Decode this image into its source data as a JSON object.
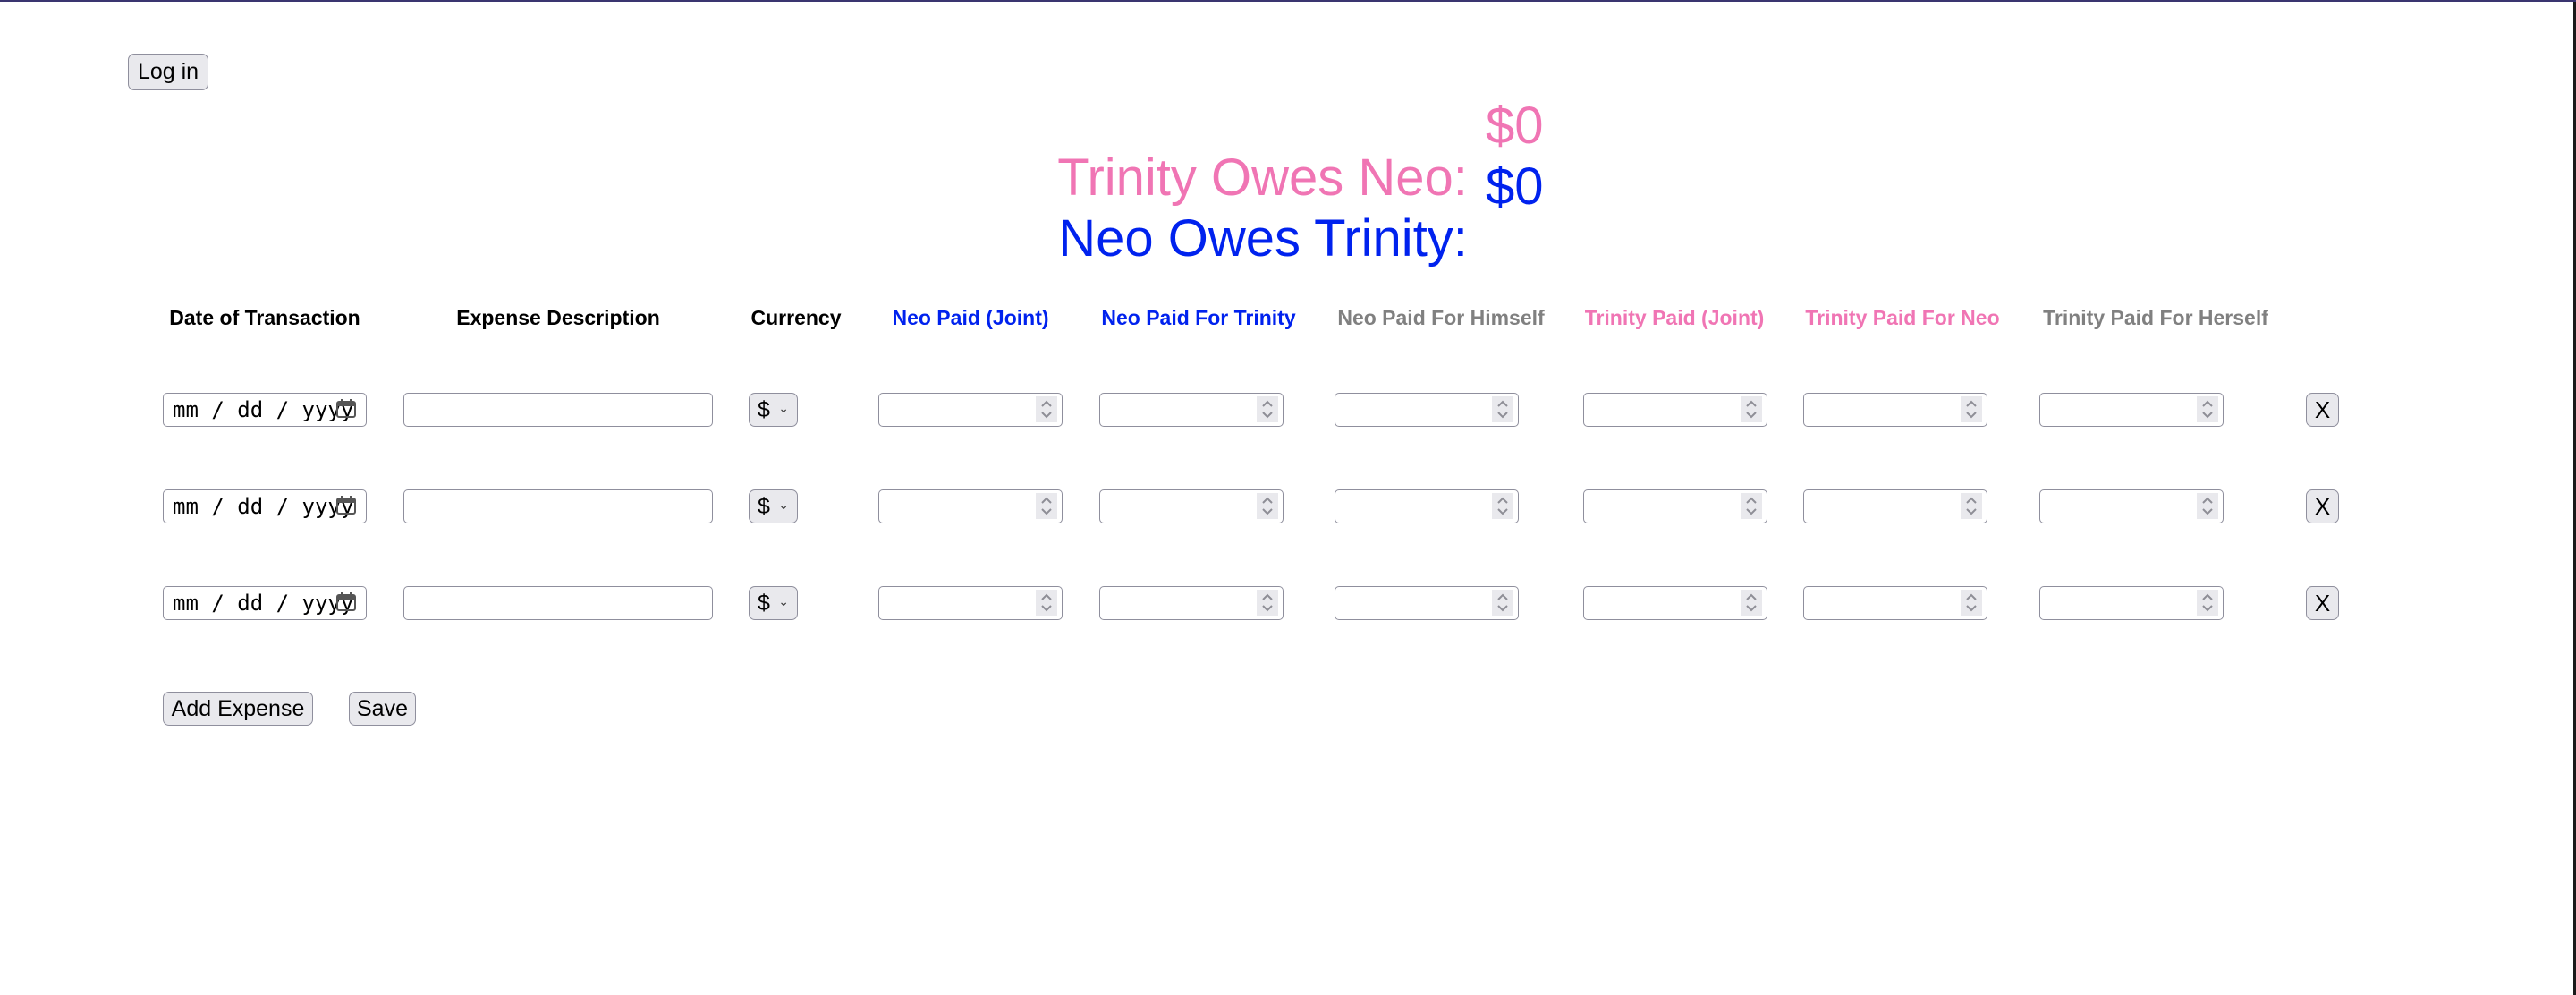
{
  "login_button": "Log in",
  "summary": {
    "trinity_owes_neo": {
      "label": "Trinity Owes Neo:",
      "amount": "$0",
      "color": "#f075b4"
    },
    "neo_owes_trinity": {
      "label": "Neo Owes Trinity:",
      "amount": "$0",
      "color": "#0022ee"
    }
  },
  "columns": [
    {
      "label": "Date of Transaction",
      "color": "#000000"
    },
    {
      "label": "Expense Description",
      "color": "#000000"
    },
    {
      "label": "Currency",
      "color": "#000000"
    },
    {
      "label": "Neo Paid (Joint)",
      "color": "#0022ee"
    },
    {
      "label": "Neo Paid For Trinity",
      "color": "#0022ee"
    },
    {
      "label": "Neo Paid For Himself",
      "color": "#808080"
    },
    {
      "label": "Trinity Paid (Joint)",
      "color": "#f075b4"
    },
    {
      "label": "Trinity Paid For Neo",
      "color": "#f075b4"
    },
    {
      "label": "Trinity Paid For Herself",
      "color": "#808080"
    }
  ],
  "rows": [
    {
      "date_placeholder": "mm / dd / yyyy",
      "description": "",
      "currency": "$",
      "amounts": [
        "",
        "",
        "",
        "",
        "",
        ""
      ],
      "delete_label": "X"
    },
    {
      "date_placeholder": "mm / dd / yyyy",
      "description": "",
      "currency": "$",
      "amounts": [
        "",
        "",
        "",
        "",
        "",
        ""
      ],
      "delete_label": "X"
    },
    {
      "date_placeholder": "mm / dd / yyyy",
      "description": "",
      "currency": "$",
      "amounts": [
        "",
        "",
        "",
        "",
        "",
        ""
      ],
      "delete_label": "X"
    }
  ],
  "actions": {
    "add_expense": "Add Expense",
    "save": "Save"
  }
}
